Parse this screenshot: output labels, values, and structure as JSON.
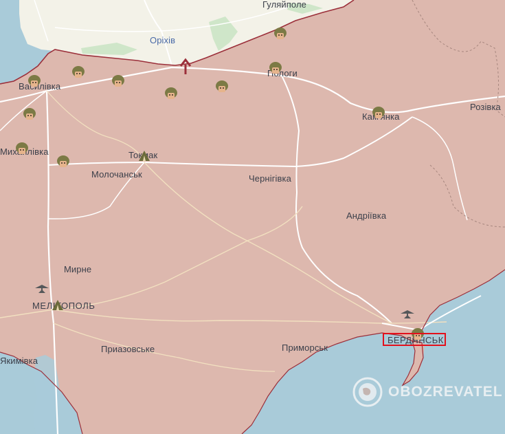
{
  "map": {
    "colors": {
      "water": "#a9cbd9",
      "free_land": "#f3f2e8",
      "occupied": "#ddb8ae",
      "front_line": "#9b2f3a",
      "forest": "#cfe6c9",
      "roads": "#ffffff",
      "highlight": "#e3101b"
    },
    "labels": {
      "huliaipole": "Гуляйполе",
      "orikhiv": "Оріхів",
      "polohy": "Пологи",
      "vasylivka": "Василівка",
      "kamianka": "Кам'янка",
      "rozivka": "Розівка",
      "mykhailivka": "Михайлівка",
      "tokmak": "Токмак",
      "molochansk": "Молочанськ",
      "chernihivka": "Чернігівка",
      "andriivka": "Андріївка",
      "myrne": "Мирне",
      "melitopol": "МЕЛІТОПОЛЬ",
      "pryazovske": "Приазовське",
      "prymorsk": "Приморськ",
      "berdiansk": "БЕРДЯНСЬК",
      "yakymivka": "Якимівка"
    },
    "icons": {
      "troops": "soldier-helmet-icon",
      "hq": "military-tent-icon",
      "airfield": "airfield-icon",
      "attack": "attack-arrow-icon"
    },
    "watermark": "OBOZREVATEL"
  }
}
